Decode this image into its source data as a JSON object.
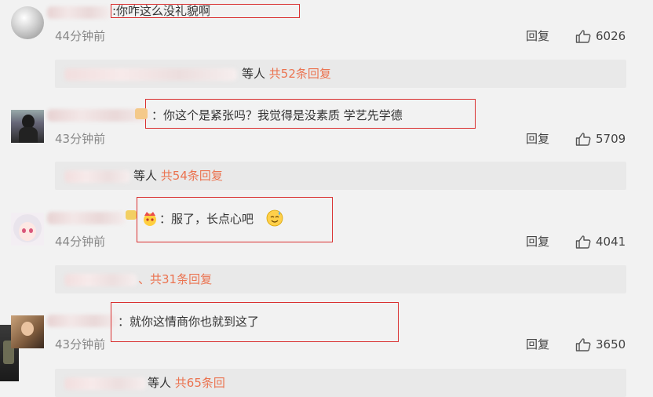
{
  "comments": [
    {
      "text": ":你咋这么没礼貌啊",
      "time": "44分钟前",
      "reply": "回复",
      "likes": "6026",
      "sub_prefix": "等人",
      "sub_count": "共52条回复"
    },
    {
      "text": "：你这个是紧张吗？我觉得是没素质 学艺先学德",
      "time": "43分钟前",
      "reply": "回复",
      "likes": "5709",
      "sub_prefix": "等人",
      "sub_count": "共54条回复"
    },
    {
      "text": "：服了，长点心吧",
      "time": "44分钟前",
      "reply": "回复",
      "likes": "4041",
      "sub_prefix": "、",
      "sub_count": "共31条回复"
    },
    {
      "text": "：就你这情商你也就到这了",
      "time": "43分钟前",
      "reply": "回复",
      "likes": "3650",
      "sub_prefix": "等人",
      "sub_count": "共65条回"
    }
  ],
  "colors": {
    "accent": "#eb7350",
    "highlight_box": "#d93030",
    "background": "#f2f2f2",
    "subbar": "#e9e9e9"
  },
  "icons": {
    "like": "thumbs-up-outline-icon",
    "emoji_crown": "emoji-crown-icon",
    "emoji_sweat": "emoji-sweat-smile-icon"
  }
}
